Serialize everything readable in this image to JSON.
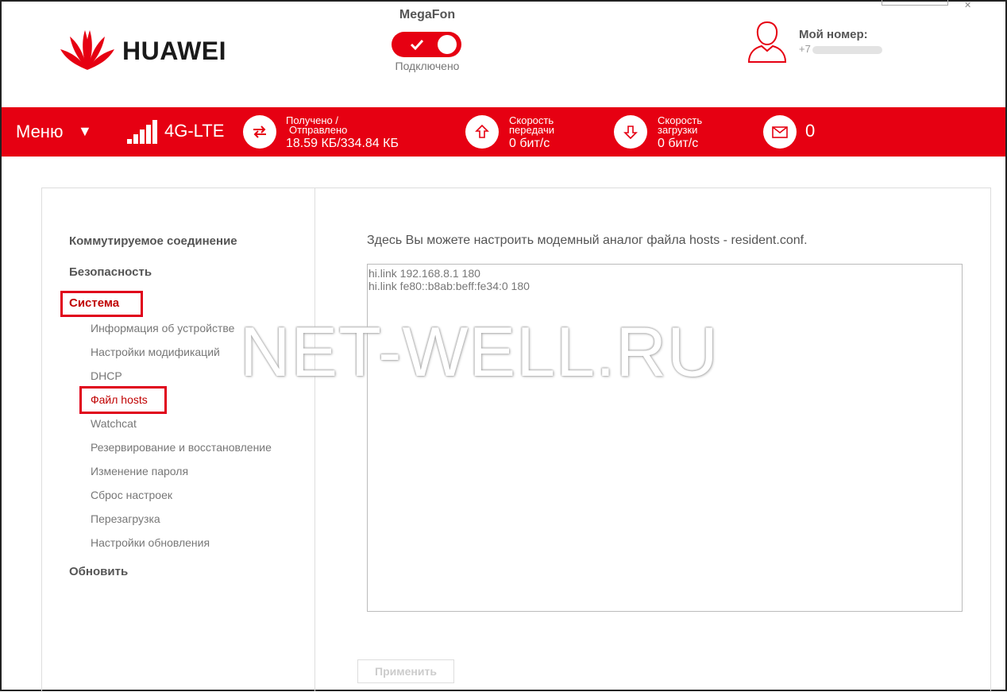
{
  "header": {
    "brand": "HUAWEI",
    "carrier": "MegaFon",
    "connection_status": "Подключено",
    "my_number_label": "Мой номер:",
    "my_number_prefix": "+7"
  },
  "status_bar": {
    "menu_label": "Меню",
    "menu_arrow": "▼",
    "network_type": "4G-LTE",
    "traffic_label_line1": "Получено /",
    "traffic_label_line2": "Отправлено",
    "traffic_value": "18.59 КБ/334.84 КБ",
    "upload_label_line1": "Скорость",
    "upload_label_line2": "передачи",
    "upload_value": "0 бит/с",
    "download_label_line1": "Скорость",
    "download_label_line2": "загрузки",
    "download_value": "0 бит/с",
    "messages_count": "0",
    "signal_bars": 5,
    "signal_bars_active": 5
  },
  "sidebar": {
    "sections": [
      {
        "label": "Коммутируемое соединение"
      },
      {
        "label": "Безопасность"
      },
      {
        "label": "Система"
      }
    ],
    "system_items": [
      {
        "label": "Информация об устройстве"
      },
      {
        "label": "Настройки модификаций"
      },
      {
        "label": "DHCP"
      },
      {
        "label": "Файл hosts"
      },
      {
        "label": "Watchcat"
      },
      {
        "label": "Резервирование и восстановление"
      },
      {
        "label": "Изменение пароля"
      },
      {
        "label": "Сброс настроек"
      },
      {
        "label": "Перезагрузка"
      },
      {
        "label": "Настройки обновления"
      }
    ],
    "last_section": "Обновить"
  },
  "main": {
    "description": "Здесь Вы можете настроить модемный аналог файла hosts - resident.conf.",
    "hosts_content": "hi.link 192.168.8.1 180\nhi.link fe80::b8ab:beff:fe34:0 180",
    "apply_label": "Применить"
  },
  "watermark": "NET-WELL.RU",
  "colors": {
    "accent": "#e60012",
    "highlight_box": "#e0001b"
  }
}
